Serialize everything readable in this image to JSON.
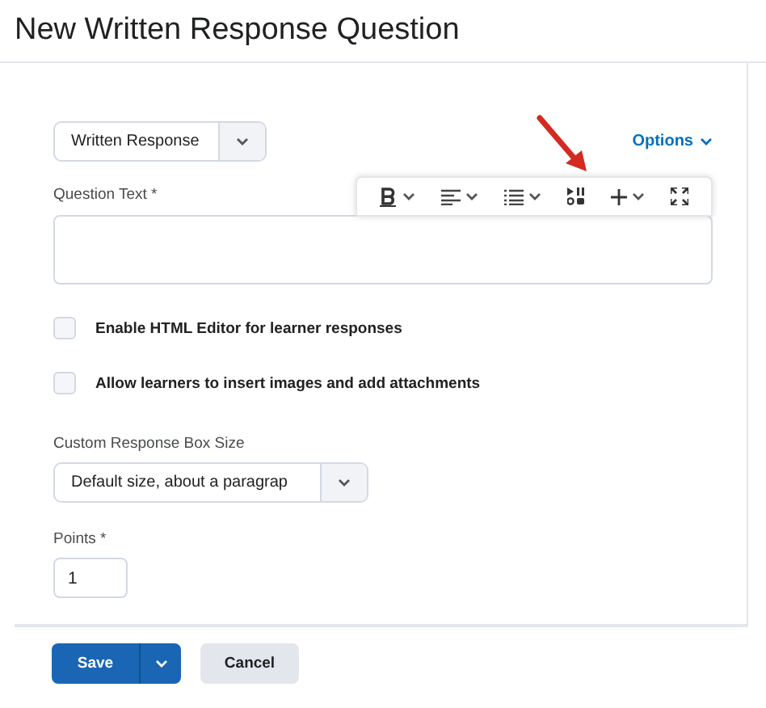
{
  "page": {
    "title": "New Written Response Question"
  },
  "question_type": {
    "value": "Written Response"
  },
  "options_link": {
    "label": "Options"
  },
  "question_text": {
    "label": "Question Text *"
  },
  "toolbar": [
    {
      "kind": "bold"
    },
    {
      "kind": "align"
    },
    {
      "kind": "list"
    },
    {
      "kind": "media"
    },
    {
      "kind": "insert"
    },
    {
      "kind": "fullscreen"
    }
  ],
  "checkboxes": [
    {
      "label": "Enable HTML Editor for learner responses",
      "checked": false
    },
    {
      "label": "Allow learners to insert images and add attachments",
      "checked": false
    }
  ],
  "response_box_size": {
    "label": "Custom Response Box Size",
    "value": "Default size, about a paragrap"
  },
  "points": {
    "label": "Points *",
    "value": "1"
  },
  "buttons": {
    "save": "Save",
    "cancel": "Cancel"
  }
}
